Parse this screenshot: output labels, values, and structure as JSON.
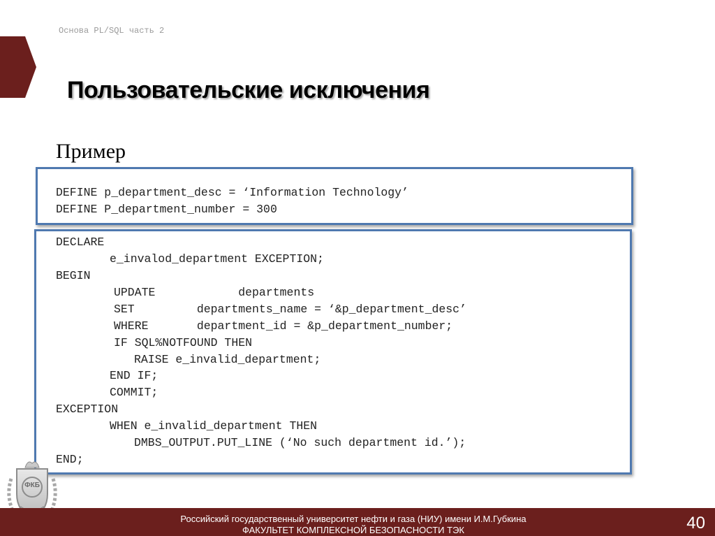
{
  "header": {
    "course": "Основа PL/SQL часть 2",
    "title": "Пользовательские исключения"
  },
  "content": {
    "subtitle": "Пример",
    "define_block": [
      "DEFINE p_department_desc = ‘Information Technology’",
      "DEFINE P_department_number = 300"
    ],
    "declare_block": [
      "DECLARE",
      "e_invalod_department EXCEPTION;",
      "BEGIN",
      "UPDATE            departments",
      "SET         departments_name = ‘&p_department_desc’",
      "WHERE       department_id = &p_department_number;",
      "IF SQL%NOTFOUND THEN",
      "RAISE e_invalid_department;",
      "END IF;",
      "COMMIT;",
      "EXCEPTION",
      "WHEN e_invalid_department THEN",
      "DMBS_OUTPUT.PUT_LINE (‘No such department id.’);",
      "END;"
    ]
  },
  "footer": {
    "university": "Российский государственный университет нефти и газа (НИУ) имени И.М.Губкина",
    "faculty": "ФАКУЛЬТЕТ КОМПЛЕКСНОЙ БЕЗОПАСНОСТИ ТЭК",
    "page_number": "40",
    "emblem_text": "ФКБ"
  },
  "colors": {
    "accent": "#6b1f1d",
    "code_border": "#4f79b0"
  }
}
